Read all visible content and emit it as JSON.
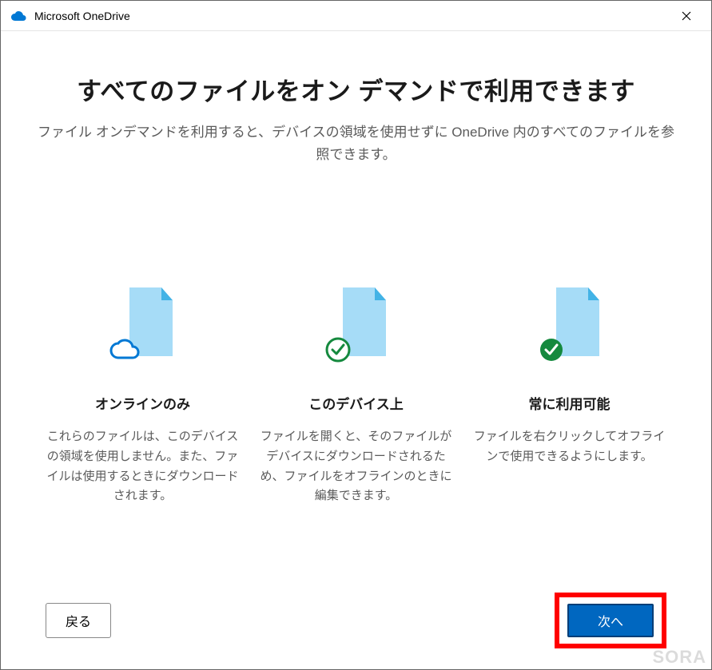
{
  "window": {
    "title": "Microsoft OneDrive"
  },
  "main": {
    "headline": "すべてのファイルをオン デマンドで利用できます",
    "subhead": "ファイル オンデマンドを利用すると、デバイスの領域を使用せずに OneDrive 内のすべてのファイルを参照できます。"
  },
  "columns": [
    {
      "title": "オンラインのみ",
      "desc": "これらのファイルは、このデバイスの領域を使用しません。また、ファイルは使用するときにダウンロードされます。"
    },
    {
      "title": "このデバイス上",
      "desc": "ファイルを開くと、そのファイルがデバイスにダウンロードされるため、ファイルをオフラインのときに編集できます。"
    },
    {
      "title": "常に利用可能",
      "desc": "ファイルを右クリックしてオフラインで使用できるようにします。"
    }
  ],
  "buttons": {
    "back": "戻る",
    "next": "次へ"
  },
  "watermark": "SORA"
}
